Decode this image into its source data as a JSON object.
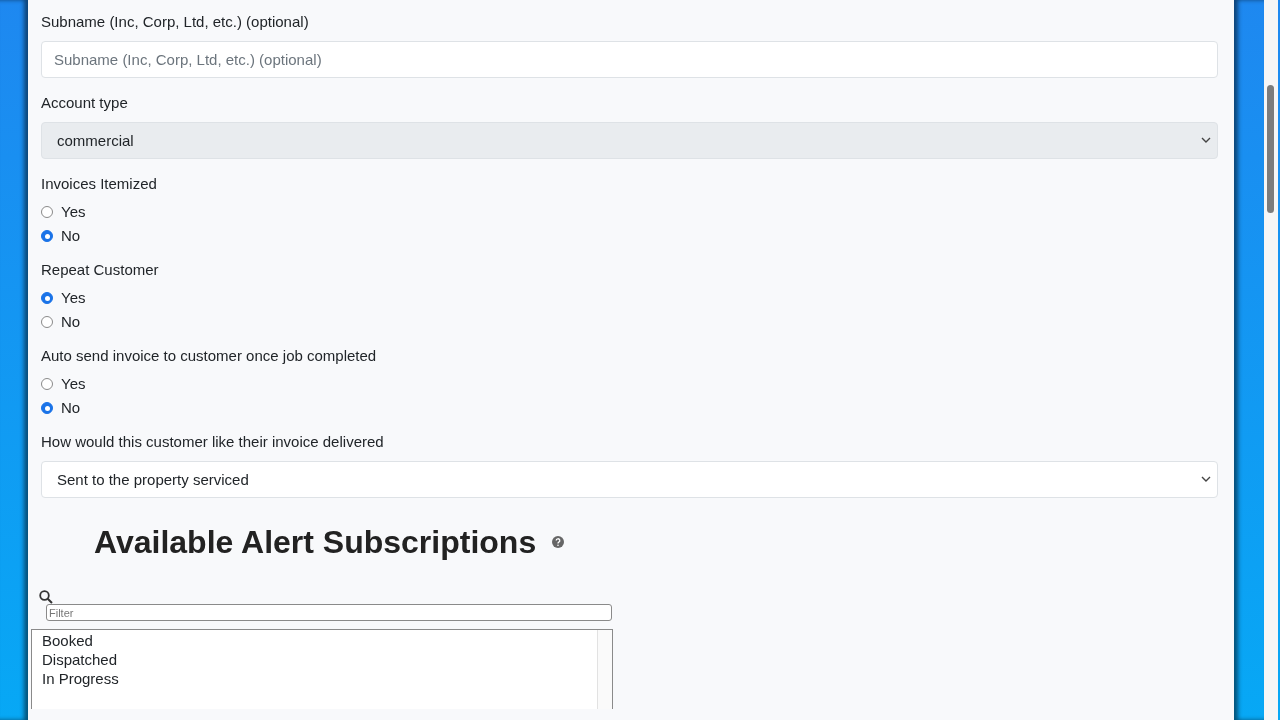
{
  "fields": [
    {
      "kind": "text",
      "label": "Subname (Inc, Corp, Ltd, etc.) (optional)",
      "placeholder": "Subname (Inc, Corp, Ltd, etc.) (optional)"
    },
    {
      "kind": "select",
      "label": "Account type",
      "value": "commercial",
      "disabled": true
    },
    {
      "kind": "radio",
      "label": "Invoices Itemized",
      "options": [
        {
          "label": "Yes",
          "selected": false
        },
        {
          "label": "No",
          "selected": true
        }
      ]
    },
    {
      "kind": "radio",
      "label": "Repeat Customer",
      "options": [
        {
          "label": "Yes",
          "selected": true
        },
        {
          "label": "No",
          "selected": false
        }
      ]
    },
    {
      "kind": "radio",
      "label": "Auto send invoice to customer once job completed",
      "options": [
        {
          "label": "Yes",
          "selected": false
        },
        {
          "label": "No",
          "selected": true
        }
      ]
    },
    {
      "kind": "select",
      "label": "How would this customer like their invoice delivered",
      "value": "Sent to the property serviced",
      "disabled": false
    }
  ],
  "alerts": {
    "title": "Available Alert Subscriptions",
    "filter": {
      "placeholder": "Filter"
    },
    "items": [
      "Booked",
      "Dispatched",
      "In Progress"
    ]
  }
}
